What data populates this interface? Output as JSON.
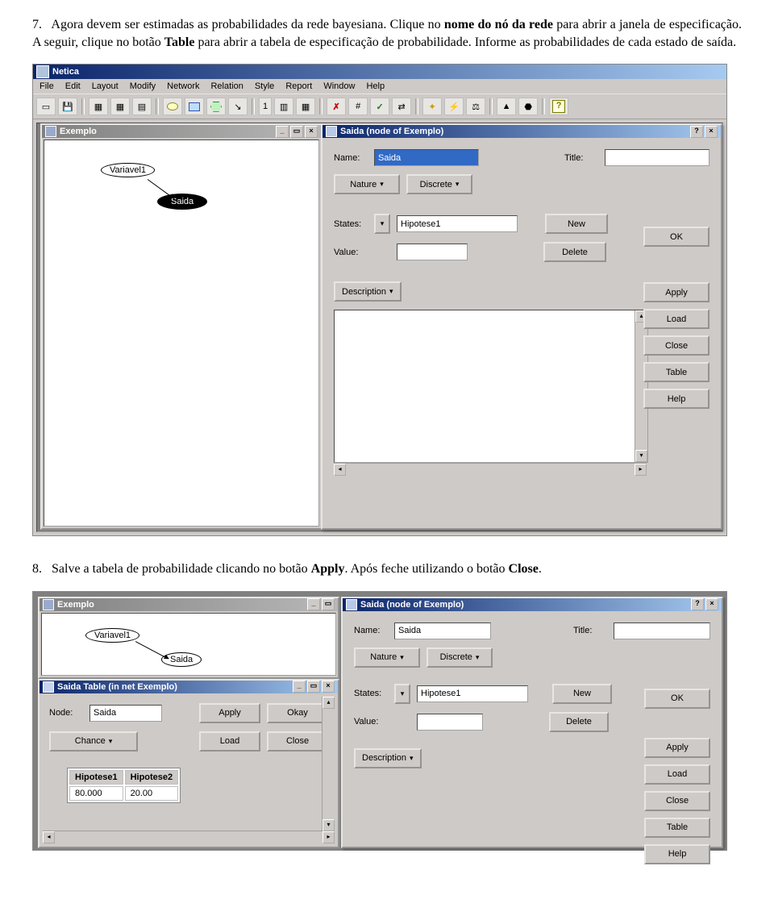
{
  "para1_num": "7.",
  "para1_a": "Agora devem ser estimadas as probabilidades da rede bayesiana. Clique no ",
  "para1_b": "nome do nó da rede",
  "para1_c": " para abrir a janela de especificação. A seguir, clique no botão ",
  "para1_d": "Table",
  "para1_e": " para abrir a tabela de especificação de probabilidade. Informe as probabilidades de cada estado de saída.",
  "para2_num": "8.",
  "para2_a": "Salve a tabela de probabilidade clicando no botão ",
  "para2_b": "Apply",
  "para2_c": ". Após feche utilizando o botão ",
  "para2_d": "Close",
  "para2_e": ".",
  "app_title": "Netica",
  "menu": {
    "file": "File",
    "edit": "Edit",
    "layout": "Layout",
    "modify": "Modify",
    "network": "Network",
    "relation": "Relation",
    "style": "Style",
    "report": "Report",
    "window": "Window",
    "help": "Help"
  },
  "tb": {
    "num1": "1"
  },
  "exemplo_title": "Exemplo",
  "node_var1": "Variavel1",
  "node_saida": "Saida",
  "dlg": {
    "title": "Saida (node of Exemplo)",
    "name_lbl": "Name:",
    "name_val": "Saida",
    "title_lbl": "Title:",
    "title_val": "",
    "nature": "Nature",
    "discrete": "Discrete",
    "states_lbl": "States:",
    "states_val": "Hipotese1",
    "new_btn": "New",
    "value_lbl": "Value:",
    "value_val": "",
    "delete_btn": "Delete",
    "desc_btn": "Description",
    "ok": "OK",
    "apply": "Apply",
    "load": "Load",
    "close": "Close",
    "table": "Table",
    "help": "Help"
  },
  "tablewin": {
    "title": "Saida Table (in net Exemplo)",
    "node_lbl": "Node:",
    "node_val": "Saida",
    "apply": "Apply",
    "okay": "Okay",
    "load": "Load",
    "close": "Close",
    "chance": "Chance",
    "h1": "Hipotese1",
    "h2": "Hipotese2",
    "v1": "80.000",
    "v2": "20.00"
  }
}
